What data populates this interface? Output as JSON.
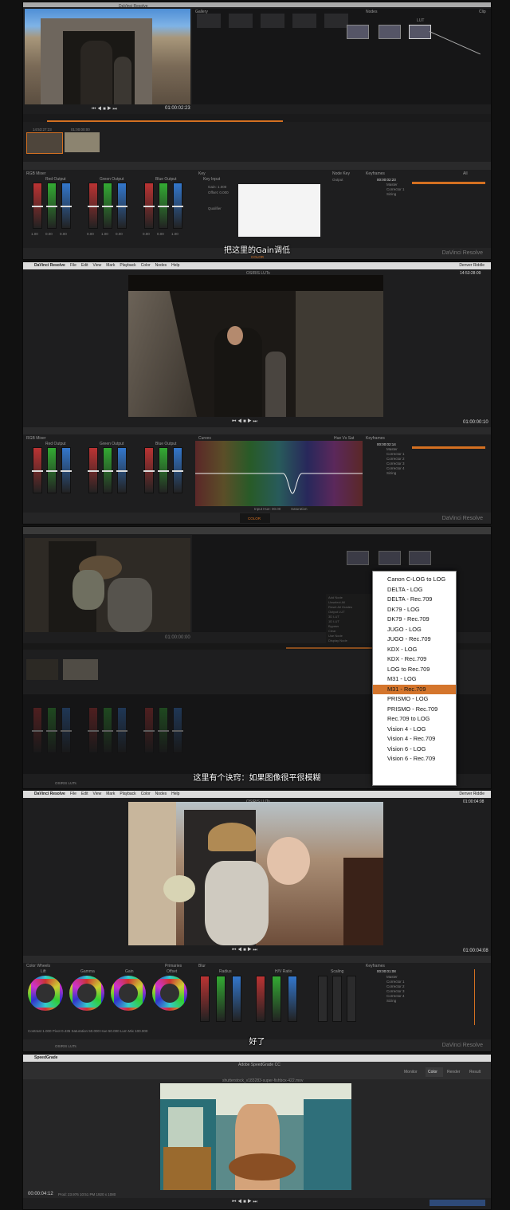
{
  "panel1": {
    "title": "DaVinci Resolve",
    "timecode": "01:00:02:23",
    "gallery_label": "Gallery",
    "nodes_label": "Nodes",
    "lut_label": "LUT",
    "clip_label": "Clip",
    "clip_tc1": "14:53:27:23",
    "clip_tc2": "01:00:00:00",
    "rgb_mixer": "RGB Mixer",
    "red_output": "Red Output",
    "green_output": "Green Output",
    "blue_output": "Blue Output",
    "key_label": "Key",
    "key_input": "Key Input",
    "gain": "Gain: 1.000",
    "offset": "Offset: 0.000",
    "key_output": "Key Output",
    "qualifier": "Qualifier",
    "node_key": "Node Key",
    "output": "Output",
    "keyframes": "Keyframes",
    "all": "All",
    "kf_tc": "00:00:02:23",
    "master": "Master",
    "corrector1": "Corrector 1",
    "sizing": "Sizing",
    "brand": "DaVinci Resolve",
    "subtitle": "把这里的Gain调低",
    "tab_color": "COLOR",
    "bar_values": [
      "1.00",
      "0.00",
      "0.00",
      "0.00",
      "1.00",
      "0.00",
      "0.00",
      "0.00",
      "1.00"
    ]
  },
  "panel2": {
    "menu": [
      "DaVinci Resolve",
      "File",
      "Edit",
      "View",
      "Mark",
      "Playback",
      "Color",
      "Nodes",
      "Help"
    ],
    "right": "Denver Riddle",
    "viewer_title": "OSIRIS LUTs",
    "timecode_top": "14:53:28:09",
    "timecode": "01:00:00:10",
    "rgb_mixer": "RGB Mixer",
    "red_output": "Red Output",
    "green_output": "Green Output",
    "blue_output": "Blue Output",
    "curves": "Curves",
    "hue_vs_sat": "Hue Vs Sat",
    "keyframes": "Keyframes",
    "kf_tc": "00:00:02:14",
    "master": "Master",
    "correctors": [
      "Corrector 1",
      "Corrector 2",
      "Corrector 3",
      "Corrector 4",
      "Sizing"
    ],
    "input_hue": "Input Hue: 00.00",
    "saturation": "Saturation",
    "brand": "DaVinci Resolve",
    "tab_color": "COLOR"
  },
  "panel3": {
    "lut_menu": [
      "Canon C-LOG to LOG",
      "DELTA - LOG",
      "DELTA - Rec.709",
      "DK79 - LOG",
      "DK79 - Rec.709",
      "JUGO - LOG",
      "JUGO - Rec.709",
      "KDX - LOG",
      "KDX - Rec.709",
      "LOG to Rec.709",
      "M31 - LOG",
      "M31 - Rec.709",
      "PRISMO - LOG",
      "PRISMO - Rec.709",
      "Rec.709 to LOG",
      "Vision 4 - LOG",
      "Vision 4 - Rec.709",
      "Vision 6 - LOG",
      "Vision 6 - Rec.709"
    ],
    "selected": "M31 - Rec.709",
    "timecode": "01:00:00:00",
    "subtitle": "这里有个诀窍：如果图像很平很模糊",
    "footer": "OSIRIS LUTs",
    "submenu": [
      "Add Node",
      "Unselect All",
      "Reset All Grades",
      "Output LUT",
      "3D LUT",
      "1D LUT",
      "Bypass",
      "Clear",
      "Use Node",
      "Display Node"
    ]
  },
  "panel4": {
    "menu": [
      "DaVinci Resolve",
      "File",
      "Edit",
      "View",
      "Mark",
      "Playback",
      "Color",
      "Nodes",
      "Help"
    ],
    "right": "Denver Riddle",
    "viewer_title": "OSIRIS LUTs",
    "timecode_top": "01:00:04:08",
    "timecode": "01:00:04:08",
    "color_wheels": "Color Wheels",
    "primaries": "Primaries",
    "wheel_labels": [
      "Lift",
      "Gamma",
      "Gain",
      "Offset"
    ],
    "blur": "Blur",
    "radius": "Radius",
    "hv_ratio": "H/V Ratio",
    "scaling": "Scaling",
    "keyframes": "Keyframes",
    "kf_tc": "00:00:01:08",
    "master": "Master",
    "correctors": [
      "Corrector 1",
      "Corrector 2",
      "Corrector 3",
      "Corrector 4",
      "Sizing"
    ],
    "bottom_values": "Contrast 1.000   Pivot 0.435   Saturation 50.000   Hue 50.000   Lum Mix 100.000",
    "footer": "OSIRIS LUTs",
    "subtitle": "好了",
    "brand": "DaVinci Resolve"
  },
  "panel5": {
    "app": "SpeedGrade",
    "window_title": "Adobe SpeedGrade CC",
    "file_name": "shutterstock_v183283-super-fishbox-422.mov",
    "tabs": [
      "Monitor",
      "Color",
      "Render",
      "Result"
    ],
    "timecode": "00:00:04:12",
    "info": "Prod: 23.976   10:51 PM   1920 x 1080"
  },
  "colors": {
    "accent_orange": "#d47021",
    "menu_selected": "#d4752c",
    "panel_bg": "#1e1e1f"
  }
}
